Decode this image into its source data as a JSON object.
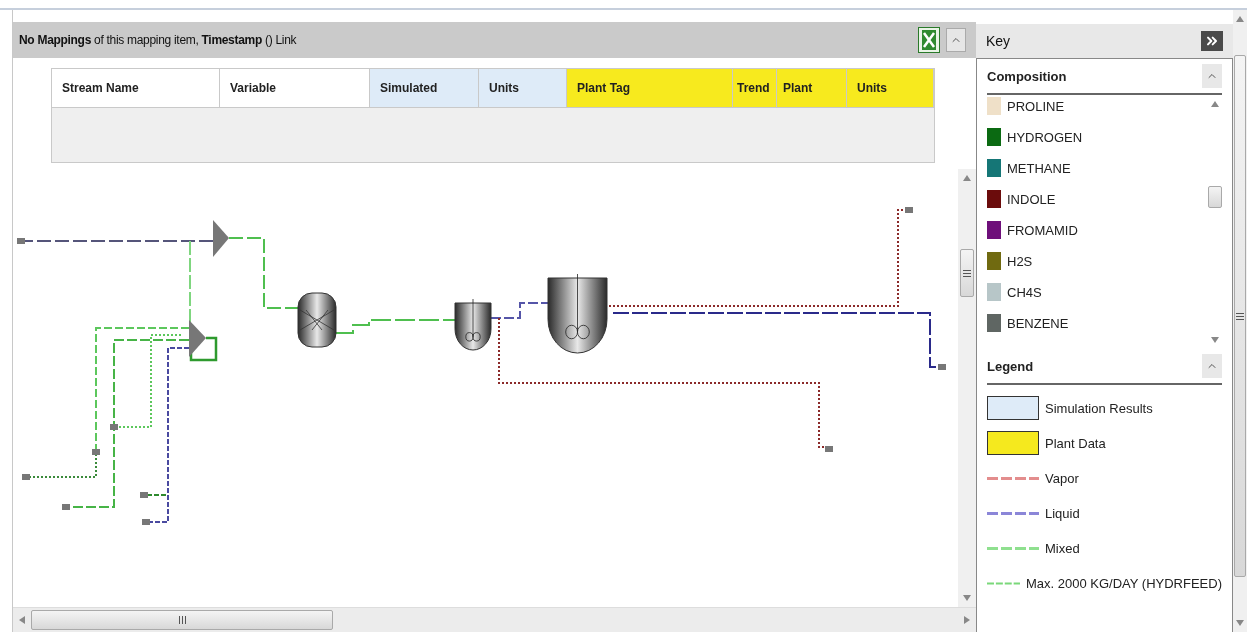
{
  "header": {
    "title": "**No Mappings** of this mapping item, **Timestamp** () Link",
    "expanded": true
  },
  "table": {
    "columns": [
      {
        "label": "Stream Name",
        "color": "#ffffff"
      },
      {
        "label": "Variable",
        "color": "#ffffff"
      },
      {
        "label": "Simulated",
        "color": "#deebf8"
      },
      {
        "label": "Units",
        "color": "#deebf8"
      },
      {
        "label": "Plant Tag",
        "color": "#f7ea1e"
      },
      {
        "label": "Trend",
        "color": "#f7ea1e"
      },
      {
        "label": "Plant",
        "color": "#f7ea1e"
      },
      {
        "label": "Units",
        "color": "#f7ea1e"
      }
    ]
  },
  "key": {
    "title": "Key",
    "composition": {
      "title": "Composition",
      "expanded": true,
      "items": [
        {
          "name": "PROLINE",
          "color": "#efe0c8"
        },
        {
          "name": "HYDROGEN",
          "color": "#0b6a12"
        },
        {
          "name": "METHANE",
          "color": "#157676"
        },
        {
          "name": "INDOLE",
          "color": "#6b0c0c"
        },
        {
          "name": "FROMAMID",
          "color": "#6e0f7a"
        },
        {
          "name": "H2S",
          "color": "#706a10"
        },
        {
          "name": "CH4S",
          "color": "#b7c6c8"
        },
        {
          "name": "BENZENE",
          "color": "#5f6663"
        }
      ]
    },
    "legend": {
      "title": "Legend",
      "expanded": true,
      "items": [
        {
          "label": "Simulation Results",
          "kind": "swatch",
          "color": "#deebf8"
        },
        {
          "label": "Plant Data",
          "kind": "swatch",
          "color": "#f5e91e"
        },
        {
          "label": "Vapor",
          "kind": "line",
          "color": "#e38d8d"
        },
        {
          "label": "Liquid",
          "kind": "line",
          "color": "#8b86d8"
        },
        {
          "label": "Mixed",
          "kind": "line",
          "color": "#8fe08f"
        },
        {
          "label": "Max. 2000 KG/DAY (HYDRFEED)",
          "kind": "line",
          "color": "#7ad87a"
        }
      ]
    }
  }
}
